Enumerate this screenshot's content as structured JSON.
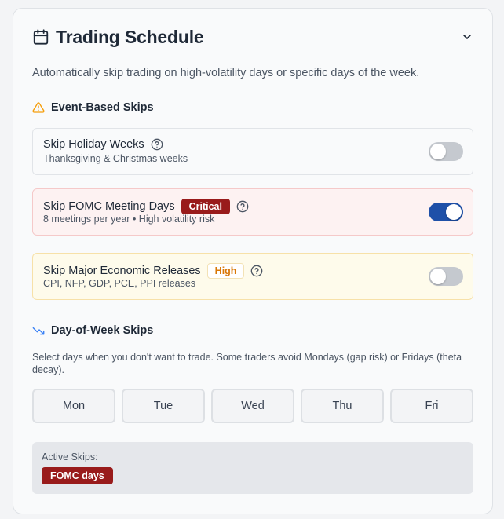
{
  "header": {
    "title": "Trading Schedule",
    "icon": "calendar-icon",
    "collapse_icon": "chevron-down-icon"
  },
  "subtitle": "Automatically skip trading on high-volatility days or specific days of the week.",
  "event_section": {
    "title": "Event-Based Skips",
    "icon": "warning-triangle-icon",
    "icon_color": "#f59e0b",
    "rows": [
      {
        "title": "Skip Holiday Weeks",
        "badge": null,
        "description": "Thanksgiving & Christmas weeks",
        "enabled": false
      },
      {
        "title": "Skip FOMC Meeting Days",
        "badge": "Critical",
        "description": "8 meetings per year • High volatility risk",
        "enabled": true
      },
      {
        "title": "Skip Major Economic Releases",
        "badge": "High",
        "description": "CPI, NFP, GDP, PCE, PPI releases",
        "enabled": false
      }
    ]
  },
  "dow_section": {
    "title": "Day-of-Week Skips",
    "icon": "trending-down-icon",
    "icon_color": "#3b82f6",
    "description": "Select days when you don't want to trade. Some traders avoid Mondays (gap risk) or Fridays (theta decay).",
    "days": [
      "Mon",
      "Tue",
      "Wed",
      "Thu",
      "Fri"
    ]
  },
  "active_skips": {
    "label": "Active Skips:",
    "tags": [
      "FOMC days"
    ]
  },
  "colors": {
    "critical": "#991b1b",
    "high": "#d97706",
    "toggle_on": "#1e50a8",
    "toggle_off": "#c5c9cf"
  }
}
